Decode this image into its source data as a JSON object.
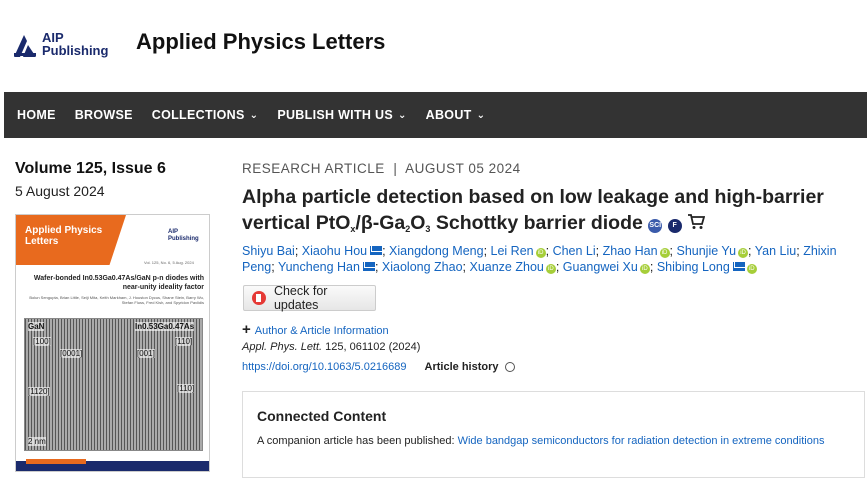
{
  "header": {
    "logo_line1": "AIP",
    "logo_line2": "Publishing",
    "journal_title": "Applied Physics Letters"
  },
  "nav": [
    {
      "label": "HOME",
      "dropdown": false
    },
    {
      "label": "BROWSE",
      "dropdown": false
    },
    {
      "label": "COLLECTIONS",
      "dropdown": true
    },
    {
      "label": "PUBLISH WITH US",
      "dropdown": true
    },
    {
      "label": "ABOUT",
      "dropdown": true
    }
  ],
  "issue": {
    "volume": "Volume 125, Issue 6",
    "date": "5 August 2024"
  },
  "cover": {
    "journal": "Applied Physics Letters",
    "logo": "AIP Publishing",
    "volume_line": "Vol. 125, No. 6, 5 Aug. 2024",
    "headline": "Wafer-bonded In0.53Ga0.47As/GaN p-n diodes with near-unity ideality factor",
    "authors": "Bolun Sengupta, Brian Little, Seiji Mita, Keith Markham, J. Houston Dycus, Shane Stein, Barry Wu, Stefan Fluss, Fred Kish, and Spyridon Pavlidis",
    "labels": {
      "left_material": "GaN",
      "right_material": "In0.53Ga0.47As",
      "dir1": "[100]",
      "dir2": "[0001]",
      "dir3": "[001]",
      "dir4": "[110]",
      "dir5": "[1120]",
      "dir6": "[110]",
      "scale": "2 nm"
    }
  },
  "article": {
    "type": "RESEARCH ARTICLE",
    "date": "AUGUST 05 2024",
    "title_part1": "Alpha particle detection based on low leakage and high-barrier vertical PtO",
    "title_x": "x",
    "title_slash": "/β-Ga",
    "title_2": "2",
    "title_o": "O",
    "title_3": "3",
    "title_part2": " Schottky barrier diode",
    "badges": [
      "SCI",
      "F",
      "cart"
    ],
    "authors": [
      {
        "name": "Shiyu Bai",
        "mail": false,
        "orcid": false
      },
      {
        "name": "Xiaohu Hou",
        "mail": true,
        "orcid": false
      },
      {
        "name": "Xiangdong Meng",
        "mail": false,
        "orcid": false
      },
      {
        "name": "Lei Ren",
        "mail": false,
        "orcid": true
      },
      {
        "name": "Chen Li",
        "mail": false,
        "orcid": false
      },
      {
        "name": "Zhao Han",
        "mail": false,
        "orcid": true
      },
      {
        "name": "Shunjie Yu",
        "mail": false,
        "orcid": true
      },
      {
        "name": "Yan Liu",
        "mail": false,
        "orcid": false
      },
      {
        "name": "Zhixin Peng",
        "mail": false,
        "orcid": false
      },
      {
        "name": "Yuncheng Han",
        "mail": true,
        "orcid": false
      },
      {
        "name": "Xiaolong Zhao",
        "mail": false,
        "orcid": false
      },
      {
        "name": "Xuanze Zhou",
        "mail": false,
        "orcid": true
      },
      {
        "name": "Guangwei Xu",
        "mail": false,
        "orcid": true
      },
      {
        "name": "Shibing Long",
        "mail": true,
        "orcid": true
      }
    ],
    "check_updates": "Check for updates",
    "author_info": "Author & Article Information",
    "citation_journal": "Appl. Phys. Lett.",
    "citation_rest": " 125, 061102 (2024)",
    "doi": "https://doi.org/10.1063/5.0216689",
    "history": "Article history"
  },
  "connected": {
    "title": "Connected Content",
    "text": "A companion article has been published: ",
    "link": "Wide bandgap semiconductors for radiation detection in extreme conditions"
  },
  "colors": {
    "nav_bg": "#333333",
    "link": "#1565c0",
    "accent": "#e86a1e",
    "brand": "#1a2a6c"
  }
}
